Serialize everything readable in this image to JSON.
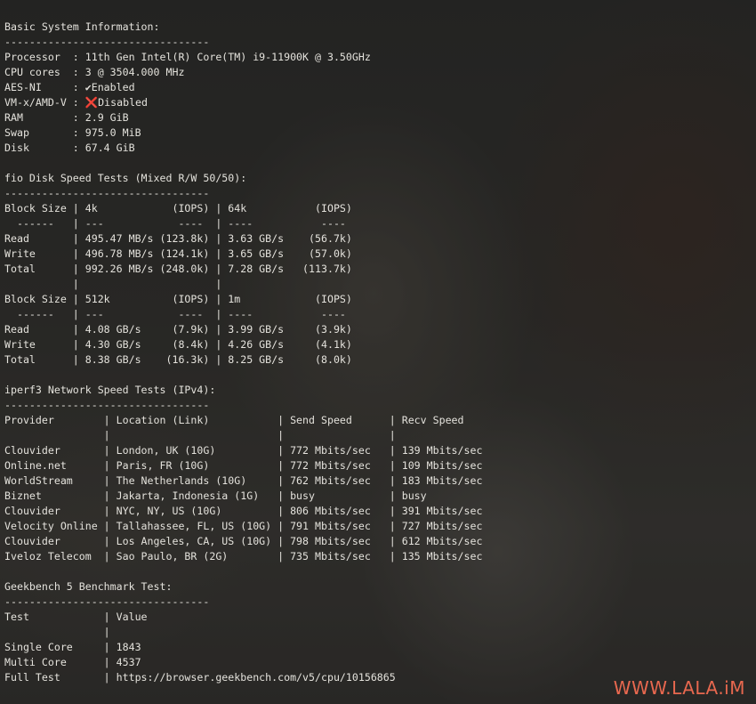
{
  "terminal": {
    "lines": [
      "Basic System Information:",
      "---------------------------------",
      "Processor  : 11th Gen Intel(R) Core(TM) i9-11900K @ 3.50GHz",
      "CPU cores  : 3 @ 3504.000 MHz",
      "AES-NI     : ✔Enabled",
      "VM-x/AMD-V : ❌Disabled",
      "RAM        : 2.9 GiB",
      "Swap       : 975.0 MiB",
      "Disk       : 67.4 GiB",
      "",
      "fio Disk Speed Tests (Mixed R/W 50/50):",
      "---------------------------------",
      "Block Size | 4k            (IOPS) | 64k           (IOPS)",
      "  ------   | ---            ----  | ----           ----",
      "Read       | 495.47 MB/s (123.8k) | 3.63 GB/s    (56.7k)",
      "Write      | 496.78 MB/s (124.1k) | 3.65 GB/s    (57.0k)",
      "Total      | 992.26 MB/s (248.0k) | 7.28 GB/s   (113.7k)",
      "           |                      |",
      "Block Size | 512k          (IOPS) | 1m            (IOPS)",
      "  ------   | ---            ----  | ----           ----",
      "Read       | 4.08 GB/s     (7.9k) | 3.99 GB/s     (3.9k)",
      "Write      | 4.30 GB/s     (8.4k) | 4.26 GB/s     (4.1k)",
      "Total      | 8.38 GB/s    (16.3k) | 8.25 GB/s     (8.0k)",
      "",
      "iperf3 Network Speed Tests (IPv4):",
      "---------------------------------",
      "Provider        | Location (Link)           | Send Speed      | Recv Speed",
      "                |                           |                 |",
      "Clouvider       | London, UK (10G)          | 772 Mbits/sec   | 139 Mbits/sec",
      "Online.net      | Paris, FR (10G)           | 772 Mbits/sec   | 109 Mbits/sec",
      "WorldStream     | The Netherlands (10G)     | 762 Mbits/sec   | 183 Mbits/sec",
      "Biznet          | Jakarta, Indonesia (1G)   | busy            | busy",
      "Clouvider       | NYC, NY, US (10G)         | 806 Mbits/sec   | 391 Mbits/sec",
      "Velocity Online | Tallahassee, FL, US (10G) | 791 Mbits/sec   | 727 Mbits/sec",
      "Clouvider       | Los Angeles, CA, US (10G) | 798 Mbits/sec   | 612 Mbits/sec",
      "Iveloz Telecom  | Sao Paulo, BR (2G)        | 735 Mbits/sec   | 135 Mbits/sec",
      "",
      "Geekbench 5 Benchmark Test:",
      "---------------------------------",
      "Test            | Value",
      "                |",
      "Single Core     | 1843",
      "Multi Core      | 4537",
      "Full Test       | https://browser.geekbench.com/v5/cpu/10156865"
    ]
  },
  "watermark": "WWW.LALA.iM"
}
